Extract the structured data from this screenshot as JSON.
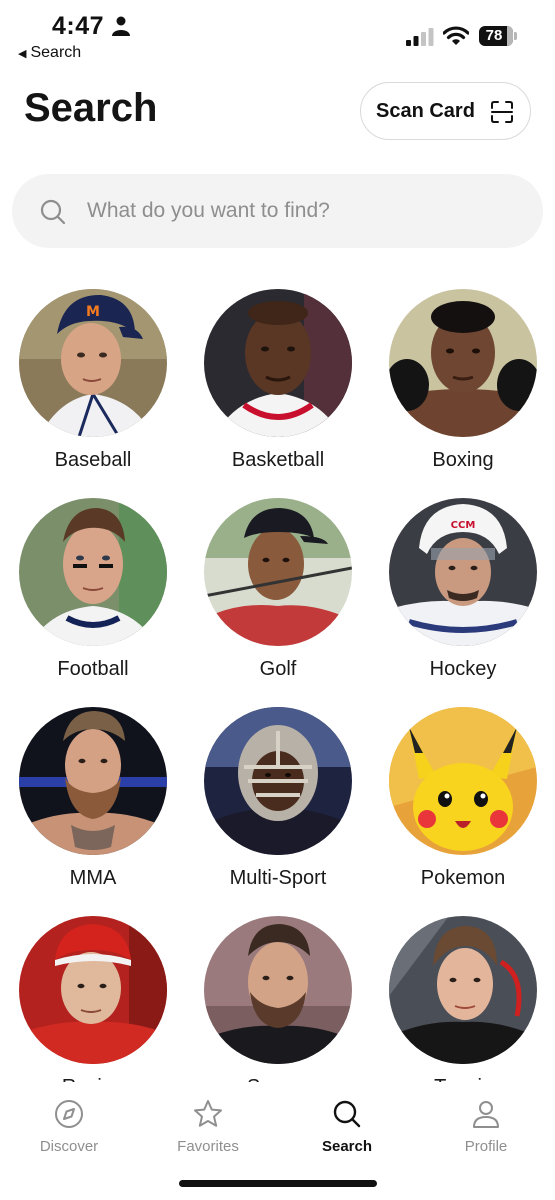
{
  "status_bar": {
    "time": "4:47",
    "back_label": "Search",
    "battery": "78"
  },
  "header": {
    "title": "Search",
    "scan_button_label": "Scan Card"
  },
  "search": {
    "placeholder": "What do you want to find?",
    "value": ""
  },
  "categories": [
    {
      "label": "Baseball"
    },
    {
      "label": "Basketball"
    },
    {
      "label": "Boxing"
    },
    {
      "label": "Football"
    },
    {
      "label": "Golf"
    },
    {
      "label": "Hockey"
    },
    {
      "label": "MMA"
    },
    {
      "label": "Multi-Sport"
    },
    {
      "label": "Pokemon"
    },
    {
      "label": "Racing"
    },
    {
      "label": "Soccer"
    },
    {
      "label": "Tennis"
    }
  ],
  "tabs": [
    {
      "label": "Discover",
      "icon": "compass-icon",
      "active": false
    },
    {
      "label": "Favorites",
      "icon": "star-icon",
      "active": false
    },
    {
      "label": "Search",
      "icon": "search-icon",
      "active": true
    },
    {
      "label": "Profile",
      "icon": "person-icon",
      "active": false
    }
  ],
  "colors": {
    "active_tab": "#111111",
    "inactive_tab": "#8f8f8f",
    "search_bg": "#f3f3f3"
  }
}
